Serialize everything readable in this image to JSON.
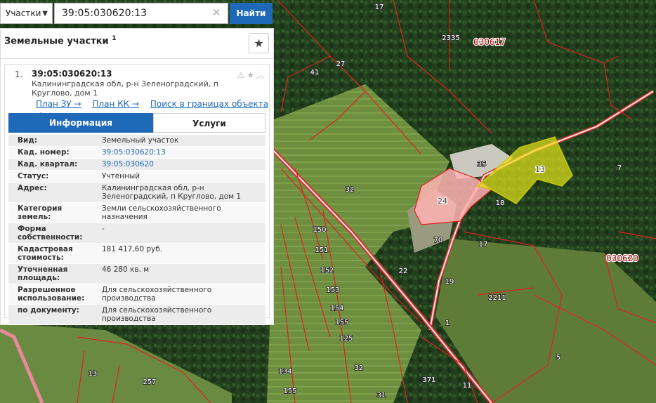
{
  "search": {
    "type_label": "Участки",
    "query": "39:05:030620:13",
    "button_label": "Найти"
  },
  "panel": {
    "title": "Земельные участки",
    "count": "1"
  },
  "result": {
    "index": "1.",
    "cad_number": "39:05:030620:13",
    "address": "Калининградская обл, р-н Зеленоградский, п Круглово, дом 1",
    "links": [
      "План ЗУ →",
      "План КК →",
      "Поиск в границах объекта →"
    ],
    "tabs": [
      "Информация",
      "Услуги"
    ],
    "active_tab": "Информация",
    "attributes": [
      {
        "key": "Вид:",
        "value": "Земельный участок"
      },
      {
        "key": "Кад. номер:",
        "value": "39:05:030620:13"
      },
      {
        "key": "Кад. квартал:",
        "value": "39:05:030620"
      },
      {
        "key": "Статус:",
        "value": "Учтенный"
      },
      {
        "key": "Адрес:",
        "value": "Калининградская обл, р-н Зеленоградский, п Круглово, дом 1"
      },
      {
        "key": "Категория земель:",
        "value": "Земли сельскохозяйственного назначения"
      },
      {
        "key": "Форма собственности:",
        "value": "-"
      },
      {
        "key": "Кадастровая стоимость:",
        "value": "181 417,60 руб."
      },
      {
        "key": "Уточненная площадь:",
        "value": "46 280 кв. м"
      },
      {
        "key": "Разрешенное использование:",
        "value": "Для сельскохозяйственного производства"
      },
      {
        "key": "по документу:",
        "value": "Для сельскохозяйственного производства"
      }
    ]
  },
  "map": {
    "quarter_labels": [
      "030617",
      "030620"
    ],
    "parcel_labels": [
      "17",
      "2335",
      "27",
      "41",
      "35",
      "13",
      "7",
      "24",
      "18",
      "32",
      "150",
      "151",
      "152",
      "153",
      "154",
      "155",
      "125",
      "70",
      "17",
      "22",
      "19",
      "2211",
      "1",
      "5",
      "13",
      "257",
      "134",
      "155",
      "32",
      "31",
      "371",
      "11"
    ],
    "colors": {
      "boundary": "#e02020",
      "road": "#d32f2f",
      "selected_fill": "#e6e61a",
      "highlight_fill": "#ffb3b3",
      "forest": "#1f3d1f",
      "field": "#7a9a4a"
    }
  }
}
